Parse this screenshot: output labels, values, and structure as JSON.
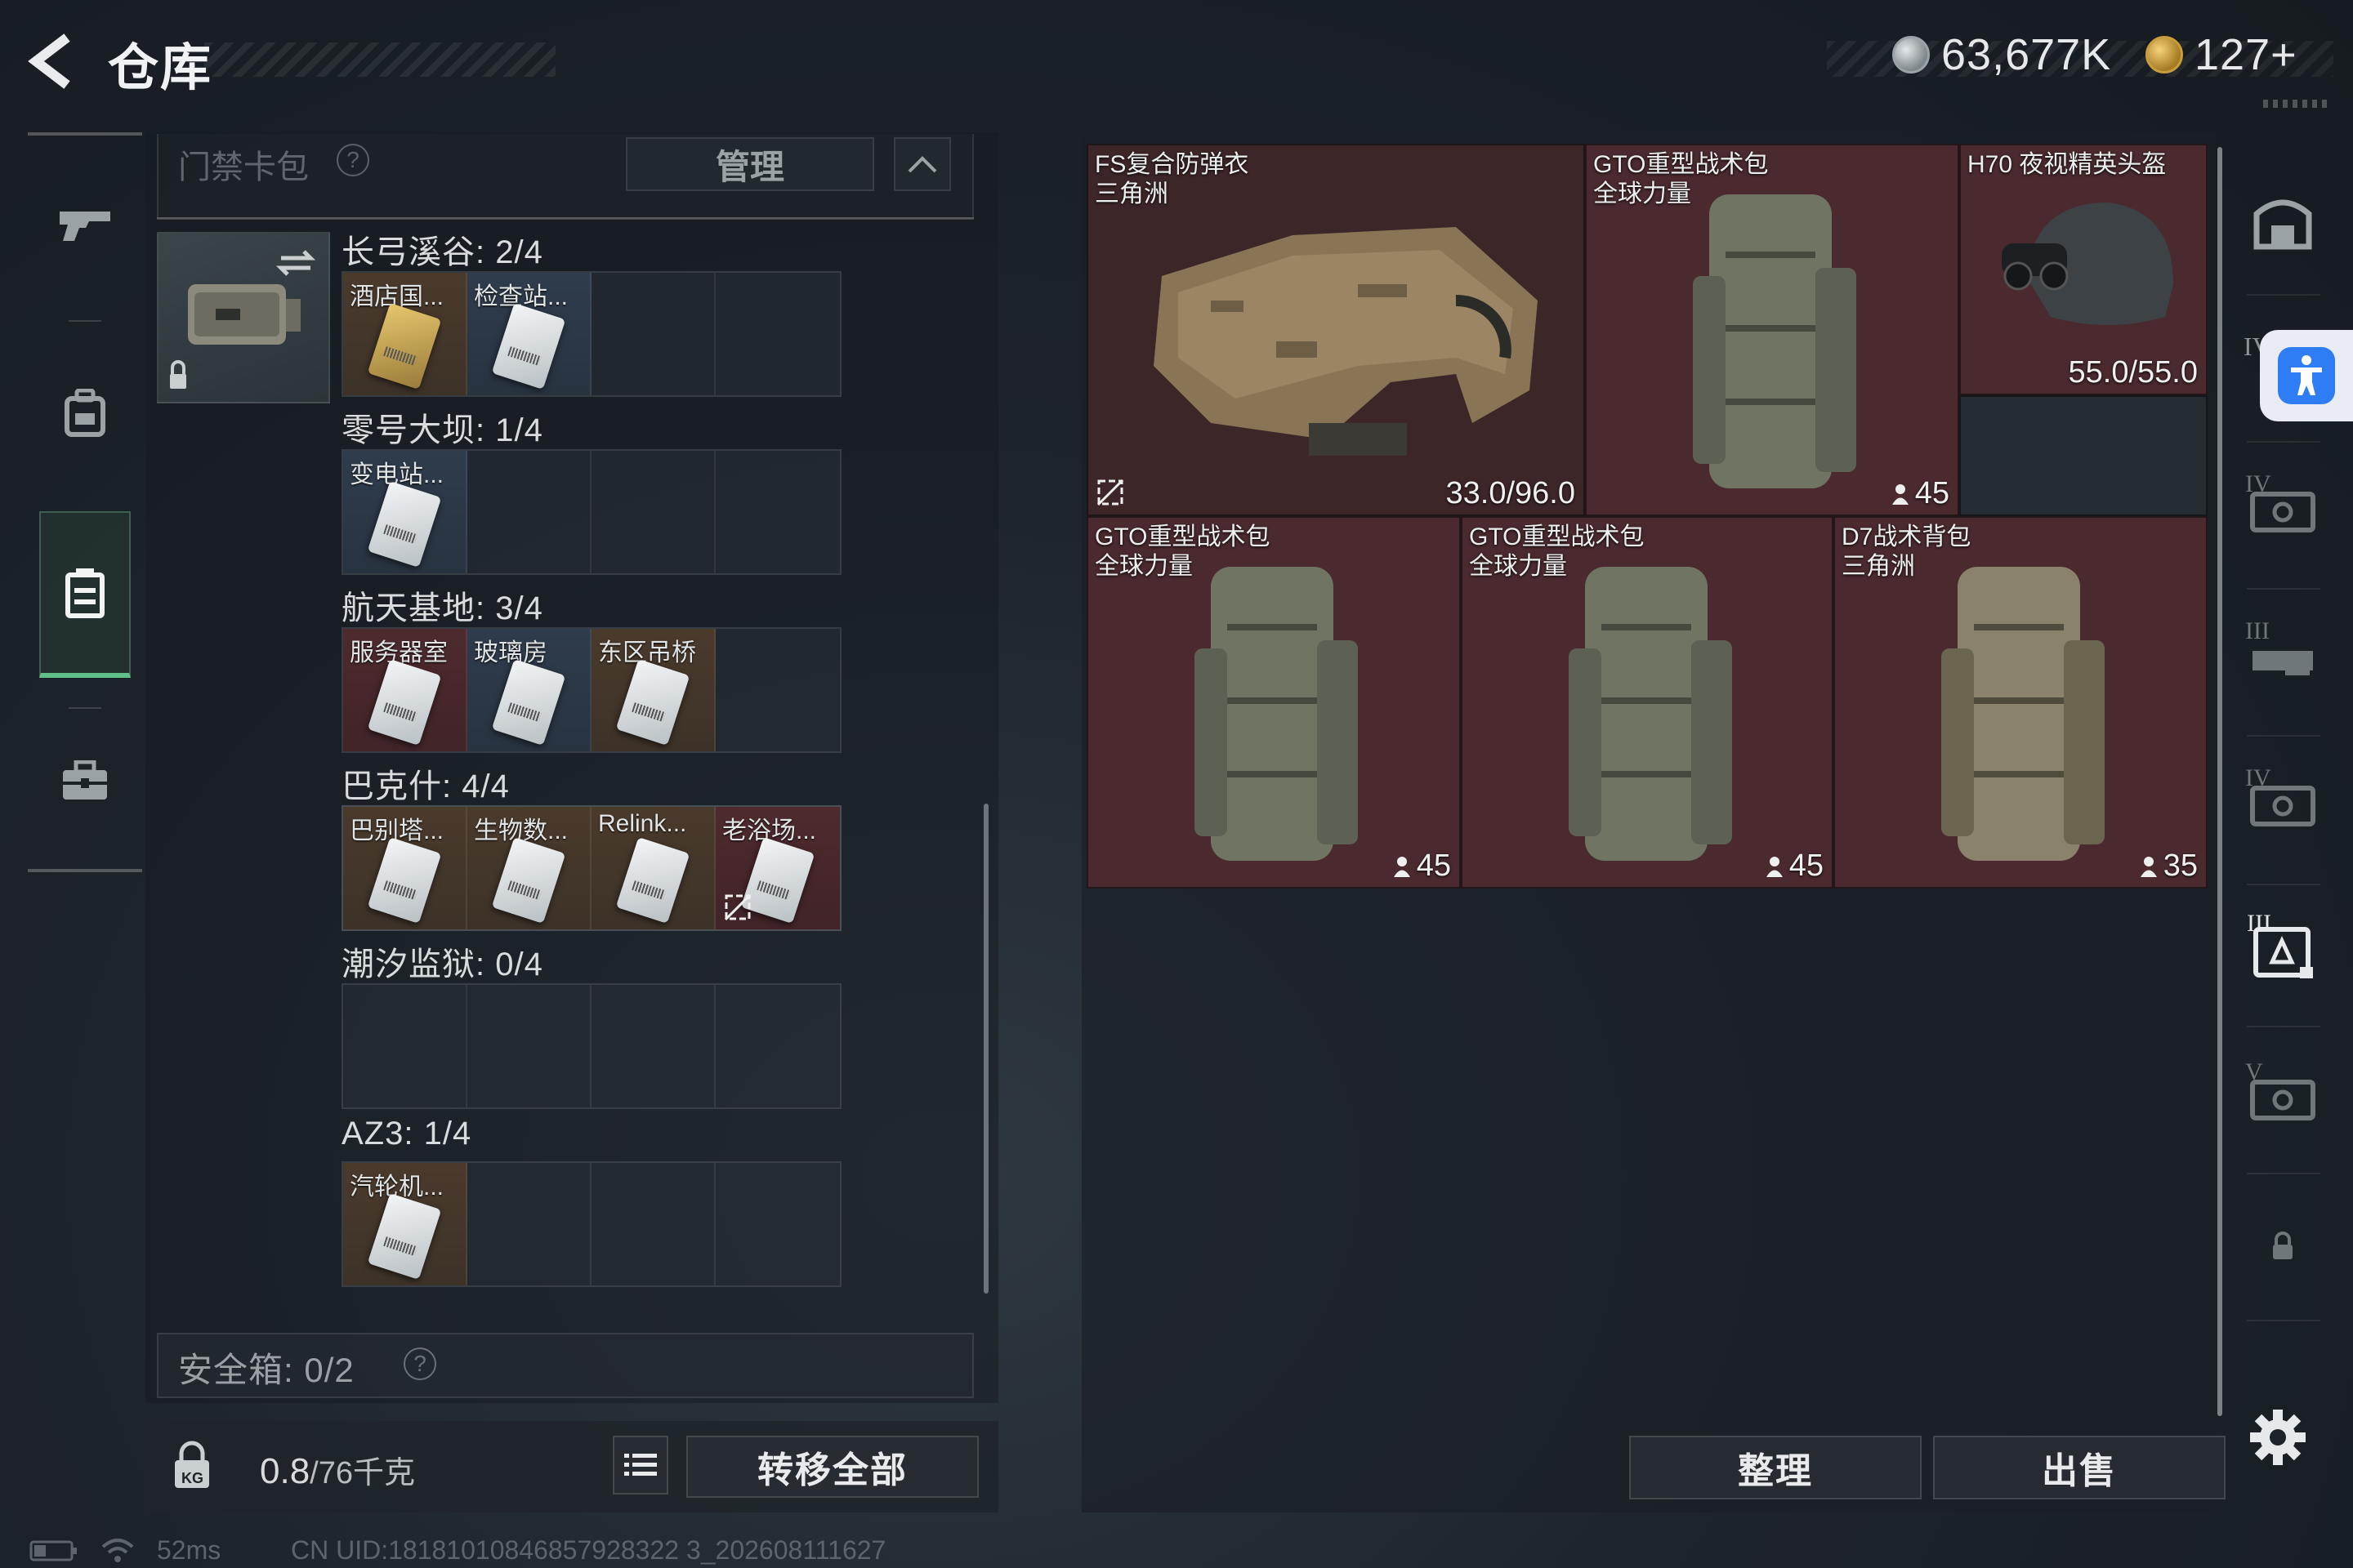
{
  "header": {
    "title": "仓库",
    "currencies": [
      {
        "icon": "silver-coin-icon",
        "value": "63,677K"
      },
      {
        "icon": "gold-coin-icon",
        "value": "127+"
      }
    ]
  },
  "left_nav": {
    "items": [
      {
        "icon": "gun-icon"
      },
      {
        "icon": "backpack-icon"
      },
      {
        "icon": "container-icon",
        "active": true
      },
      {
        "icon": "briefcase-icon"
      }
    ]
  },
  "card_pack": {
    "title": "门禁卡包",
    "help": "?",
    "manage_label": "管理",
    "groups": [
      {
        "label": "长弓溪谷: 2/4",
        "slots": [
          {
            "label": "酒店国...",
            "style": "gold"
          },
          {
            "label": "检查站...",
            "style": "blue"
          },
          {
            "label": ""
          },
          {
            "label": ""
          }
        ]
      },
      {
        "label": "零号大坝: 1/4",
        "slots": [
          {
            "label": "变电站...",
            "style": "blue"
          },
          {
            "label": ""
          },
          {
            "label": ""
          },
          {
            "label": ""
          }
        ]
      },
      {
        "label": "航天基地: 3/4",
        "slots": [
          {
            "label": "服务器室",
            "style": "red"
          },
          {
            "label": "玻璃房",
            "style": "blue"
          },
          {
            "label": "东区吊桥",
            "style": "gold"
          },
          {
            "label": ""
          }
        ]
      },
      {
        "label": "巴克什: 4/4",
        "slots": [
          {
            "label": "巴别塔...",
            "style": "gold"
          },
          {
            "label": "生物数...",
            "style": "gold"
          },
          {
            "label": "Relink...",
            "style": "gold"
          },
          {
            "label": "老浴场...",
            "style": "red"
          }
        ]
      },
      {
        "label": "潮汐监狱: 0/4",
        "slots": [
          {
            "label": ""
          },
          {
            "label": ""
          },
          {
            "label": ""
          },
          {
            "label": ""
          }
        ]
      },
      {
        "label": "AZ3: 1/4",
        "slots": [
          {
            "label": "汽轮机...",
            "style": "gold"
          },
          {
            "label": ""
          },
          {
            "label": ""
          },
          {
            "label": ""
          }
        ]
      }
    ]
  },
  "safebox": {
    "label": "安全箱: 0/2",
    "help": "?"
  },
  "bottom_left": {
    "weight_value": "0.8",
    "weight_capacity": "/76千克",
    "lock_label": "KG",
    "transfer_all_label": "转移全部"
  },
  "stash_items": [
    {
      "name_line1": "FS复合防弹衣",
      "name_line2": "三角洲",
      "value": "33.0/96.0"
    },
    {
      "name_line1": "GTO重型战术包",
      "name_line2": "全球力量",
      "value": "45"
    },
    {
      "name_line1": "H70 夜视精英头盔",
      "name_line2": "",
      "value": "55.0/55.0"
    },
    {
      "name_line1": "GTO重型战术包",
      "name_line2": "全球力量",
      "value": "45"
    },
    {
      "name_line1": "GTO重型战术包",
      "name_line2": "全球力量",
      "value": "45"
    },
    {
      "name_line1": "D7战术背包",
      "name_line2": "三角洲",
      "value": "35"
    }
  ],
  "right_tabs": {
    "labels": [
      "IV",
      "IV",
      "III",
      "IV",
      "III",
      "V"
    ]
  },
  "actions": {
    "sort_label": "整理",
    "sell_label": "出售"
  },
  "status": {
    "ping": "52ms",
    "uid": "CN UID:18181010846857928322 3_202608111627"
  },
  "colors": {
    "accent_green": "#5fc08a",
    "item_red": "#4a2a2e",
    "gold_slot": "#4a3a2c",
    "blue_slot": "#2f3c4c"
  }
}
